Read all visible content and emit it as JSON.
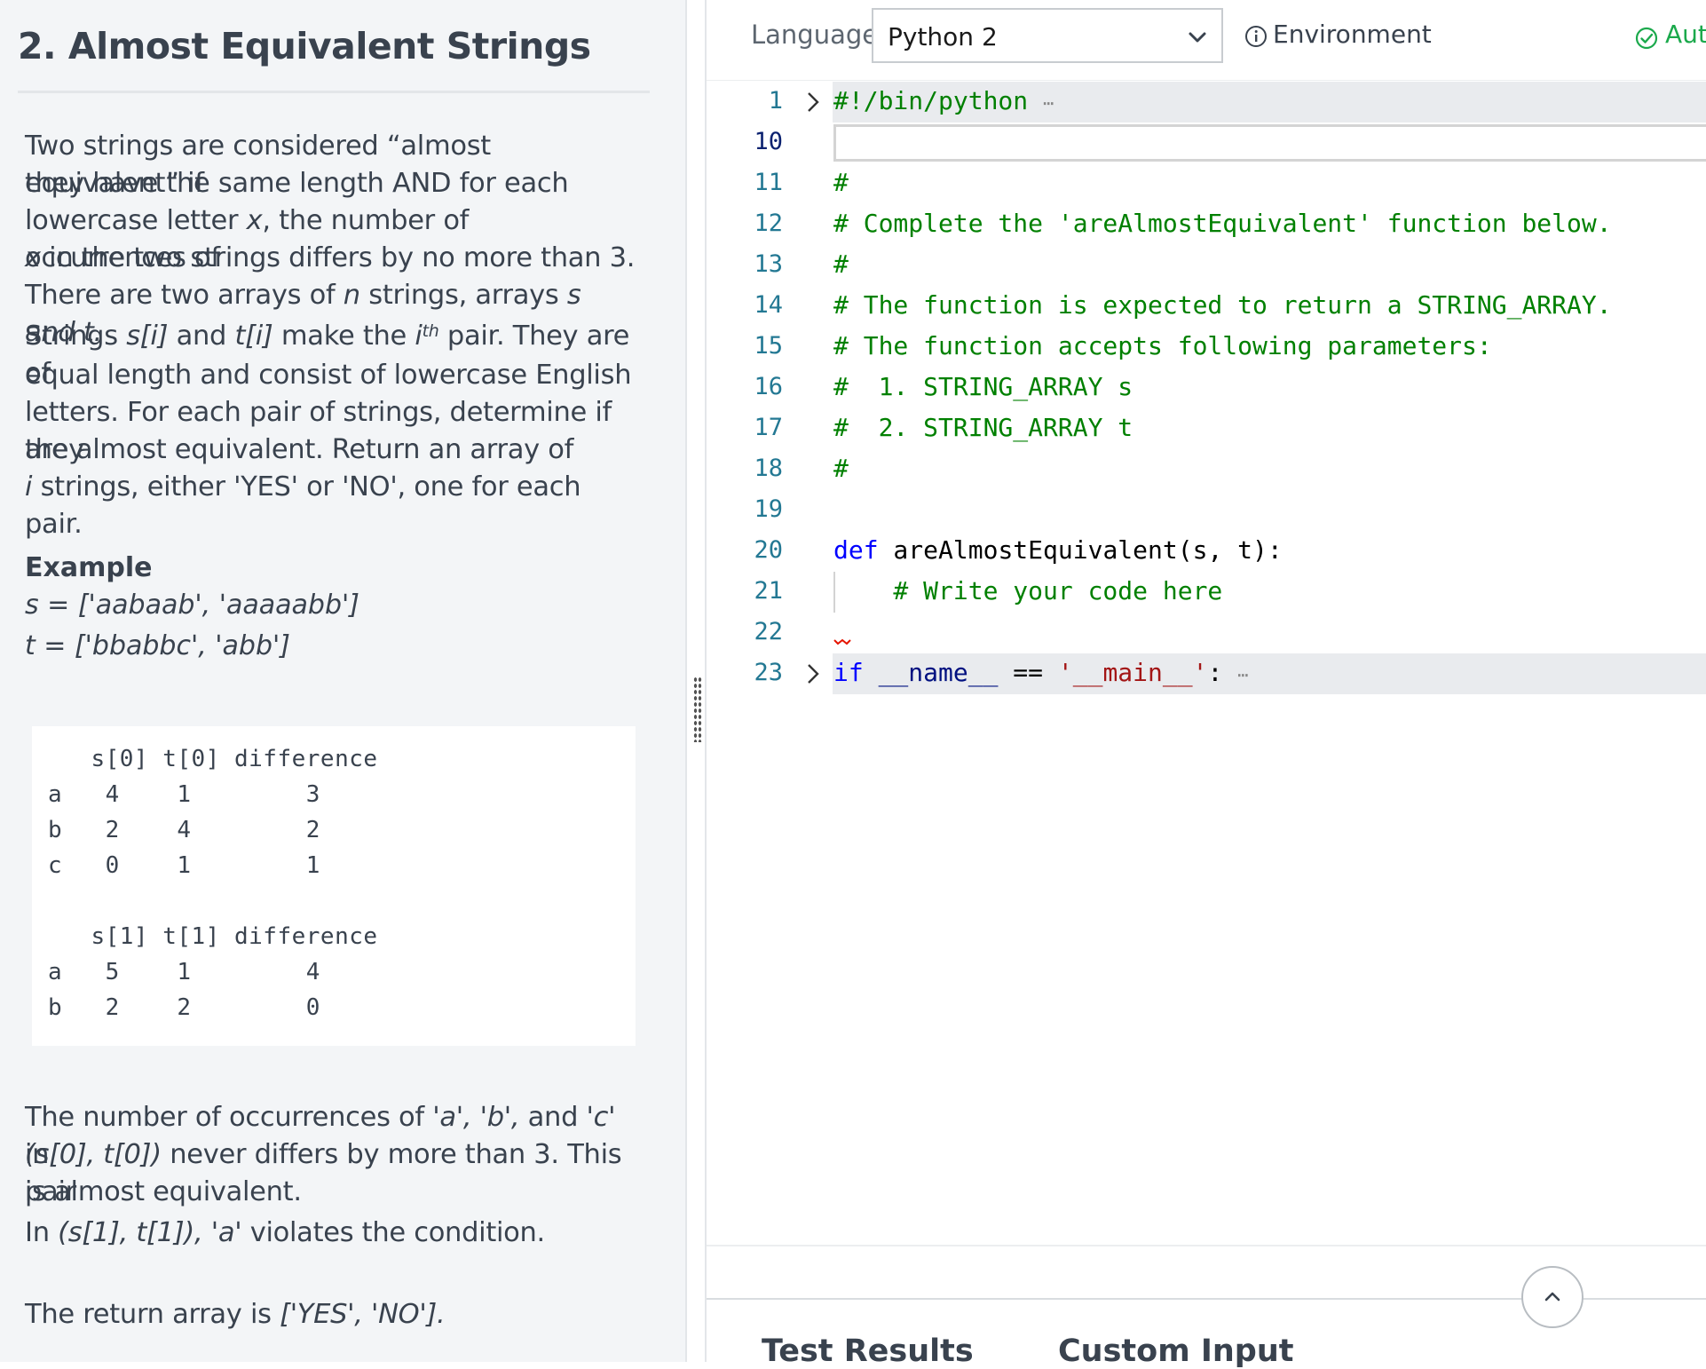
{
  "problem": {
    "title": "2. Almost Equivalent Strings",
    "description_lines": [
      "Two strings are considered “almost equivalent” if",
      "they have the same length AND for each",
      "lowercase letter x, the number of occurrences of",
      "x in the two strings differs by no more than 3.",
      "There are two arrays of n strings, arrays s and t.",
      "Strings s[i] and t[i] make the ith pair. They are of",
      "equal length and consist of lowercase English",
      "letters. For each pair of strings, determine if they",
      "are almost equivalent. Return an array of",
      "i strings, either 'YES' or 'NO', one for each pair."
    ],
    "example_heading": "Example",
    "example_s": "s = ['aabaab', 'aaaaabb']",
    "example_t": "t = ['bbabbc', 'abb']",
    "example_table_lines": [
      "   s[0] t[0] difference",
      "a   4    1        3",
      "b   2    4        2",
      "c   0    1        1",
      "",
      "   s[1] t[1] difference",
      "a   5    1        4",
      "b   2    2        0"
    ],
    "explanation_lines": [
      "The number of occurrences of 'a', 'b', and 'c' in",
      "(s[0], t[0]) never differs by more than 3. This pair",
      "is almost equivalent.",
      "In (s[1], t[1]), 'a' violates the condition."
    ],
    "return_line": "The return array is ['YES', 'NO']."
  },
  "toolbar": {
    "language_label": "Language",
    "language_value": "Python 2",
    "environment_label": "Environment",
    "autosave_label": "Aut"
  },
  "editor": {
    "lines": [
      {
        "num": "1",
        "text": "#!/bin/python",
        "folded": true
      },
      {
        "num": "10",
        "text": "",
        "active": true
      },
      {
        "num": "11",
        "text": "#"
      },
      {
        "num": "12",
        "text": "# Complete the 'areAlmostEquivalent' function below."
      },
      {
        "num": "13",
        "text": "#"
      },
      {
        "num": "14",
        "text": "# The function is expected to return a STRING_ARRAY."
      },
      {
        "num": "15",
        "text": "# The function accepts following parameters:"
      },
      {
        "num": "16",
        "text": "#  1. STRING_ARRAY s"
      },
      {
        "num": "17",
        "text": "#  2. STRING_ARRAY t"
      },
      {
        "num": "18",
        "text": "#"
      },
      {
        "num": "19",
        "text": ""
      },
      {
        "num": "20",
        "text": "def areAlmostEquivalent(s, t):"
      },
      {
        "num": "21",
        "text": "    # Write your code here"
      },
      {
        "num": "22",
        "text": ""
      },
      {
        "num": "23",
        "text": "if __name__ == '__main__':",
        "folded": true
      }
    ],
    "fold_ellipsis": "⋯"
  },
  "bottom_tabs": {
    "test_results": "Test Results",
    "custom_input": "Custom Input"
  },
  "colors": {
    "left_bg": "#f3f5f7",
    "comment": "#008000",
    "keyword": "#0000ff",
    "string": "#a31515",
    "line_number": "#237893",
    "success": "#1ba94c"
  }
}
